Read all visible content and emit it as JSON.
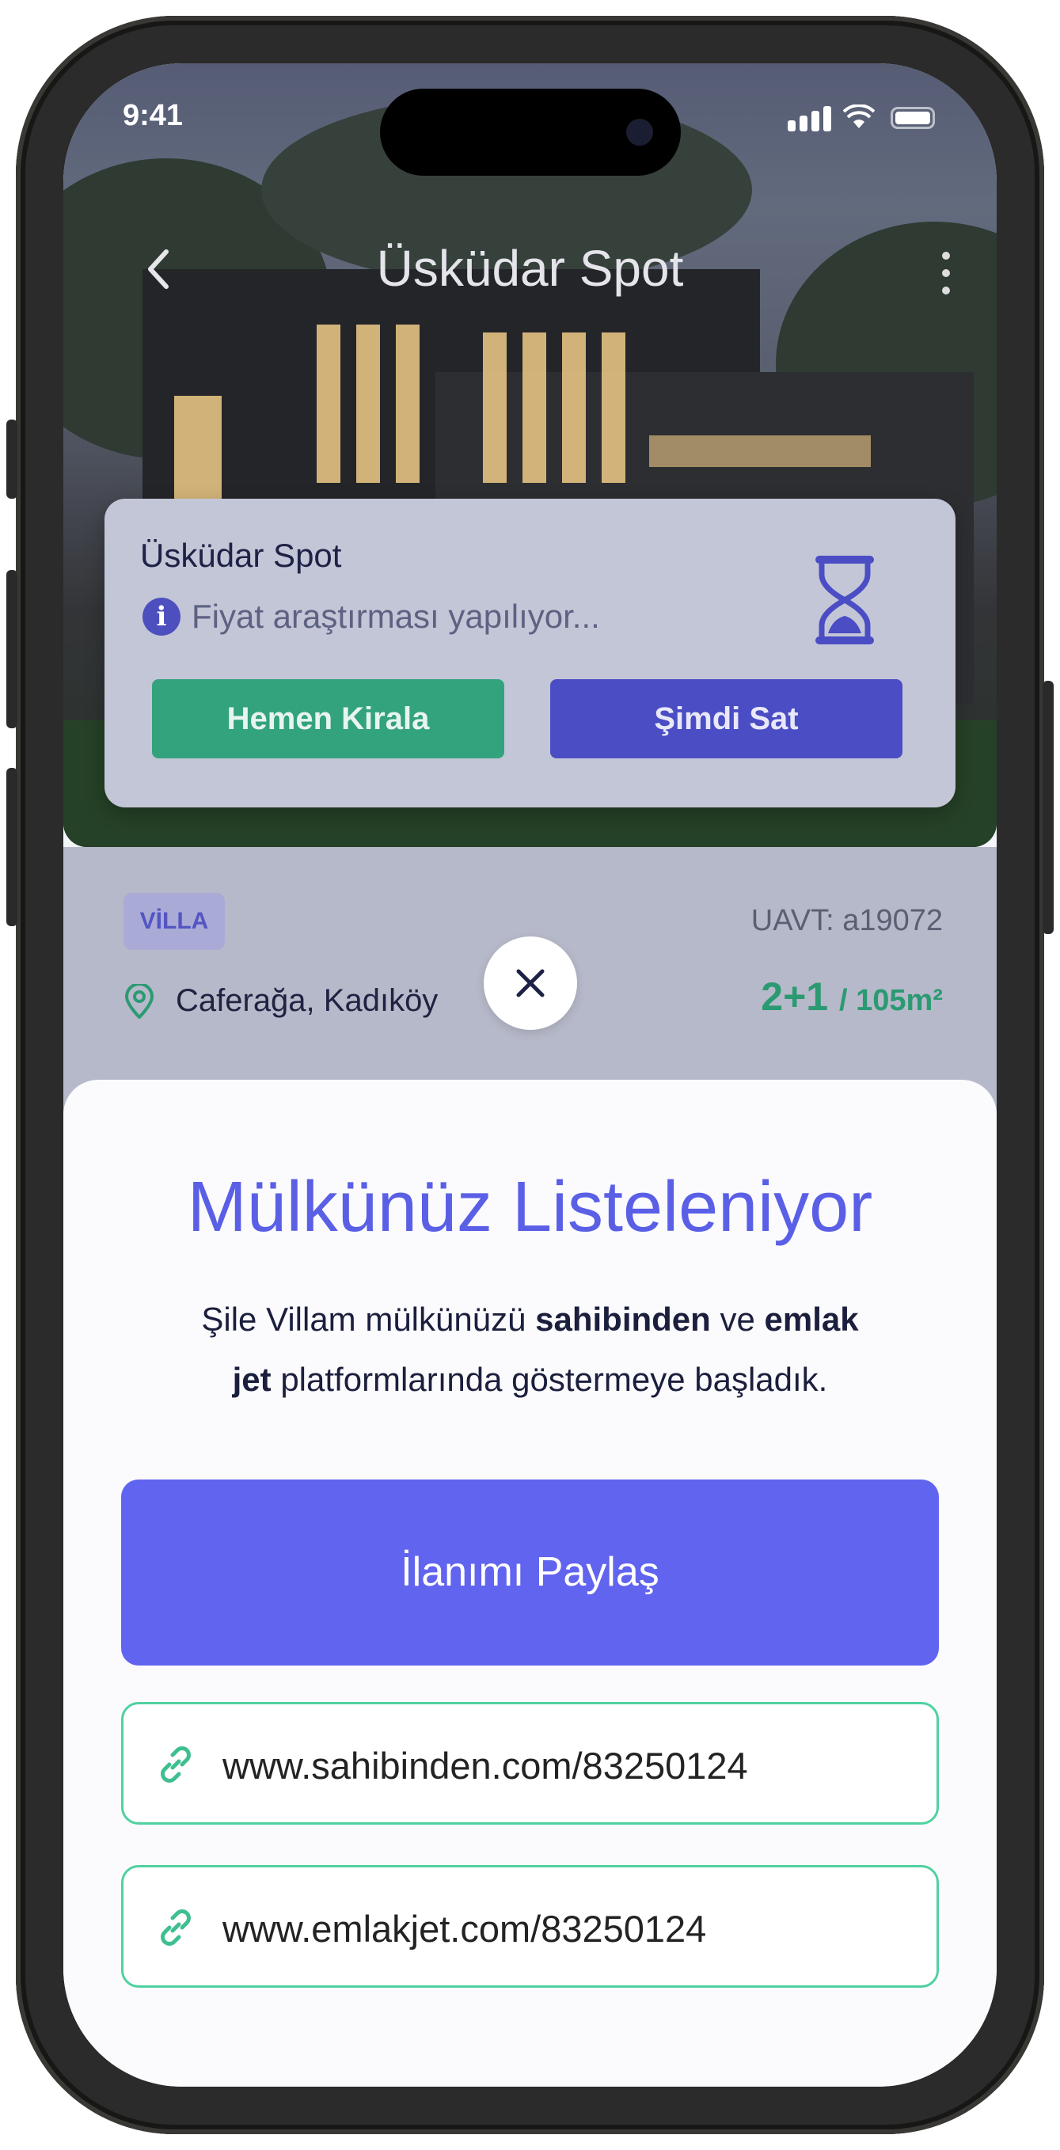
{
  "status_bar": {
    "time": "9:41"
  },
  "nav": {
    "title": "Üsküdar Spot",
    "back_icon": "chevron-left-icon",
    "more_icon": "kebab-icon"
  },
  "card": {
    "title": "Üsküdar Spot",
    "status_text": "Fiyat araştırması yapılıyor...",
    "rent_button": "Hemen Kirala",
    "sell_button": "Şimdi Sat",
    "colors": {
      "rent": "#33a37d",
      "sell": "#4a4dc4"
    }
  },
  "property": {
    "type_badge": "VİLLA",
    "uavt": "UAVT: a19072",
    "location": "Caferağa, Kadıköy",
    "rooms": "2+1",
    "area": "/ 105m²"
  },
  "sheet": {
    "title": "Mülkünüz Listeleniyor",
    "desc_part1": "Şile Villam mülkünüzü ",
    "desc_bold1": "sahibinden",
    "desc_part2": " ve ",
    "desc_bold2": "emlak jet",
    "desc_part3": " platformlarında göstermeye başladık.",
    "share_button": "İlanımı Paylaş",
    "links": [
      "www.sahibinden.com/83250124",
      "www.emlakjet.com/83250124"
    ],
    "colors": {
      "accent": "#6164ee",
      "link_border": "#4fd1a0"
    }
  }
}
